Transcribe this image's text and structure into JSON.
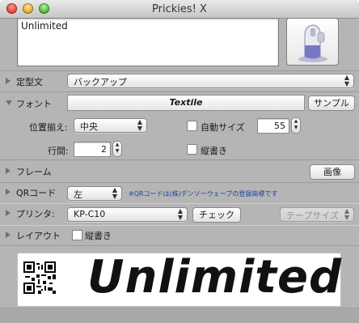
{
  "window": {
    "title": "Prickies! X"
  },
  "text_input": {
    "value": "Unlimited"
  },
  "rows": {
    "template": {
      "label": "定型文",
      "value": "バックアップ"
    },
    "font": {
      "label": "フォント",
      "font_name": "Textile",
      "sample_label": "サンプル",
      "align_label": "位置揃え:",
      "align_value": "中央",
      "autosize_label": "自動サイズ",
      "size_value": "55",
      "line_label": "行間:",
      "line_value": "2",
      "vertical_label": "縦書き"
    },
    "frame": {
      "label": "フレーム",
      "image_label": "画像"
    },
    "qr": {
      "label": "QRコード",
      "value": "左",
      "note": "※QRコードは(株)デンソーウェーブの登録商標です"
    },
    "printer": {
      "label": "プリンタ:",
      "value": "KP-C10",
      "check_label": "チェック",
      "tape_label": "テープサイズ"
    },
    "layout": {
      "label": "レイアウト",
      "vertical_label": "縦書き"
    }
  },
  "preview": {
    "text": "Unlimited"
  },
  "icons": [
    "close-button",
    "minimize-button",
    "zoom-button",
    "printer-icon",
    "disclosure-triangle-icon",
    "qr-code-icon"
  ]
}
